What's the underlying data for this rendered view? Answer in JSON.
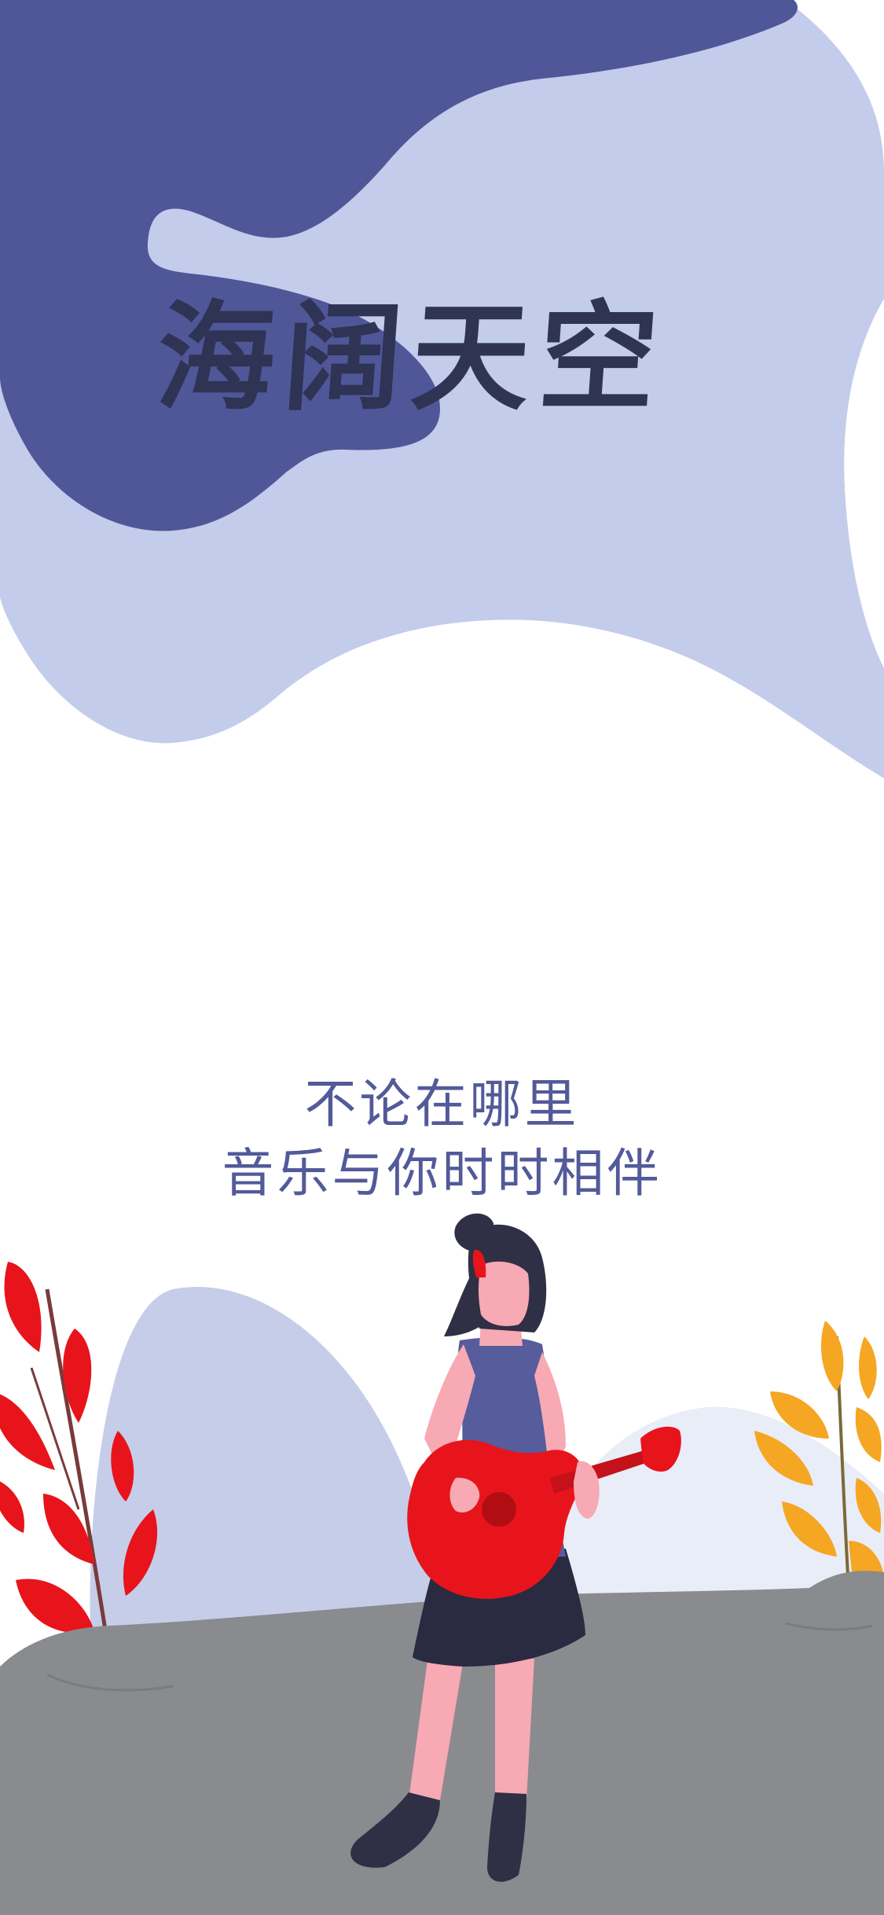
{
  "splash": {
    "app_title": "海阔天空",
    "slogan_line1": "不论在哪里",
    "slogan_line2": "音乐与你时时相伴"
  },
  "colors": {
    "background": "#ffffff",
    "blob_dark": "#4f5799",
    "blob_light": "#c3cceb",
    "title_text": "#2f3354",
    "slogan_text": "#525a99",
    "ground": "#8a8b8f",
    "hill": "#c6cde9",
    "guitar": "#e8141c",
    "skin": "#f7a9b4",
    "hair": "#2f2f45",
    "shirt": "#565c9c",
    "skirt": "#2a2a40",
    "plant_red": "#e8141c",
    "plant_yellow": "#f5a623"
  },
  "illustration": {
    "subject": "girl-playing-red-guitar",
    "plants": [
      "red-leaf-plant",
      "yellow-leaf-plant"
    ]
  }
}
